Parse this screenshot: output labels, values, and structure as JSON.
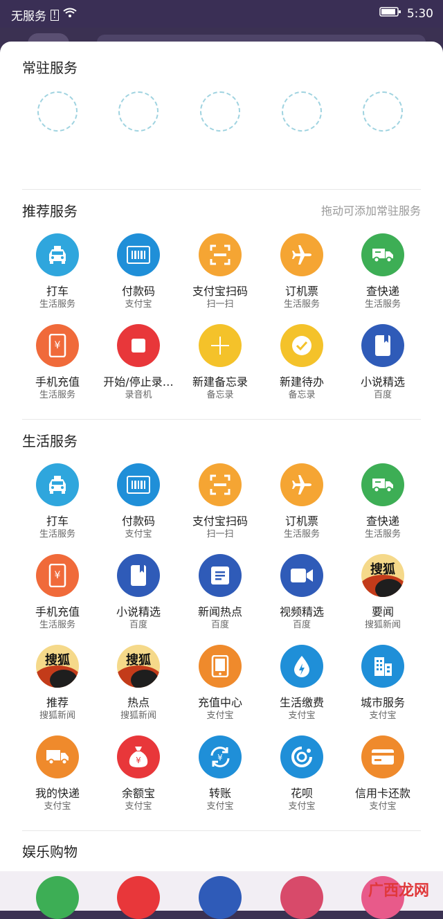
{
  "status_bar": {
    "carrier": "无服务",
    "time": "5:30"
  },
  "pinned": {
    "title": "常驻服务"
  },
  "recommended": {
    "title": "推荐服务",
    "hint": "拖动可添加常驻服务",
    "items": [
      {
        "label": "打车",
        "sub": "生活服务",
        "icon": "taxi-icon",
        "color": "#2fa6dd"
      },
      {
        "label": "付款码",
        "sub": "支付宝",
        "icon": "barcode-icon",
        "color": "#1f8fd8"
      },
      {
        "label": "支付宝扫码",
        "sub": "扫一扫",
        "icon": "scan-icon",
        "color": "#f5a533"
      },
      {
        "label": "订机票",
        "sub": "生活服务",
        "icon": "airplane-icon",
        "color": "#f5a533"
      },
      {
        "label": "查快递",
        "sub": "生活服务",
        "icon": "truck-icon",
        "color": "#3dae55"
      },
      {
        "label": "手机充值",
        "sub": "生活服务",
        "icon": "phone-recharge-icon",
        "color": "#f06a3a"
      },
      {
        "label": "开始/停止录…",
        "sub": "录音机",
        "icon": "stop-icon",
        "color": "#e8373a"
      },
      {
        "label": "新建备忘录",
        "sub": "备忘录",
        "icon": "plus-icon",
        "color": "#f4c22a"
      },
      {
        "label": "新建待办",
        "sub": "备忘录",
        "icon": "check-icon",
        "color": "#f4c22a"
      },
      {
        "label": "小说精选",
        "sub": "百度",
        "icon": "book-icon",
        "color": "#2f5bb8"
      }
    ]
  },
  "life": {
    "title": "生活服务",
    "items": [
      {
        "label": "打车",
        "sub": "生活服务",
        "icon": "taxi-icon",
        "color": "#2fa6dd"
      },
      {
        "label": "付款码",
        "sub": "支付宝",
        "icon": "barcode-icon",
        "color": "#1f8fd8"
      },
      {
        "label": "支付宝扫码",
        "sub": "扫一扫",
        "icon": "scan-icon",
        "color": "#f5a533"
      },
      {
        "label": "订机票",
        "sub": "生活服务",
        "icon": "airplane-icon",
        "color": "#f5a533"
      },
      {
        "label": "查快递",
        "sub": "生活服务",
        "icon": "truck-icon",
        "color": "#3dae55"
      },
      {
        "label": "手机充值",
        "sub": "生活服务",
        "icon": "phone-recharge-icon",
        "color": "#f06a3a"
      },
      {
        "label": "小说精选",
        "sub": "百度",
        "icon": "book-icon",
        "color": "#2f5bb8"
      },
      {
        "label": "新闻热点",
        "sub": "百度",
        "icon": "news-icon",
        "color": "#2f5bb8"
      },
      {
        "label": "视频精选",
        "sub": "百度",
        "icon": "video-icon",
        "color": "#2f5bb8"
      },
      {
        "label": "要闻",
        "sub": "搜狐新闻",
        "icon": "sohu-logo",
        "color": "#f5d98a",
        "logo_text": "搜狐"
      },
      {
        "label": "推荐",
        "sub": "搜狐新闻",
        "icon": "sohu-logo",
        "color": "#f5d98a",
        "logo_text": "搜狐"
      },
      {
        "label": "热点",
        "sub": "搜狐新闻",
        "icon": "sohu-logo",
        "color": "#f5d98a",
        "logo_text": "搜狐"
      },
      {
        "label": "充值中心",
        "sub": "支付宝",
        "icon": "tablet-icon",
        "color": "#ef8a2c"
      },
      {
        "label": "生活缴费",
        "sub": "支付宝",
        "icon": "water-drop-icon",
        "color": "#1f8fd8"
      },
      {
        "label": "城市服务",
        "sub": "支付宝",
        "icon": "building-icon",
        "color": "#1f8fd8"
      },
      {
        "label": "我的快递",
        "sub": "支付宝",
        "icon": "delivery-truck-icon",
        "color": "#ef8a2c"
      },
      {
        "label": "余额宝",
        "sub": "支付宝",
        "icon": "money-bag-icon",
        "color": "#e8373a"
      },
      {
        "label": "转账",
        "sub": "支付宝",
        "icon": "transfer-icon",
        "color": "#1f8fd8"
      },
      {
        "label": "花呗",
        "sub": "支付宝",
        "icon": "huabei-icon",
        "color": "#1f8fd8"
      },
      {
        "label": "信用卡还款",
        "sub": "支付宝",
        "icon": "credit-card-icon",
        "color": "#ef8a2c"
      }
    ]
  },
  "entertainment": {
    "title": "娱乐购物",
    "bottom_colors": [
      "#3dae55",
      "#e8373a",
      "#2f5bb8",
      "#d84a6a",
      "#e85a8a"
    ]
  },
  "watermark": "广西龙网"
}
